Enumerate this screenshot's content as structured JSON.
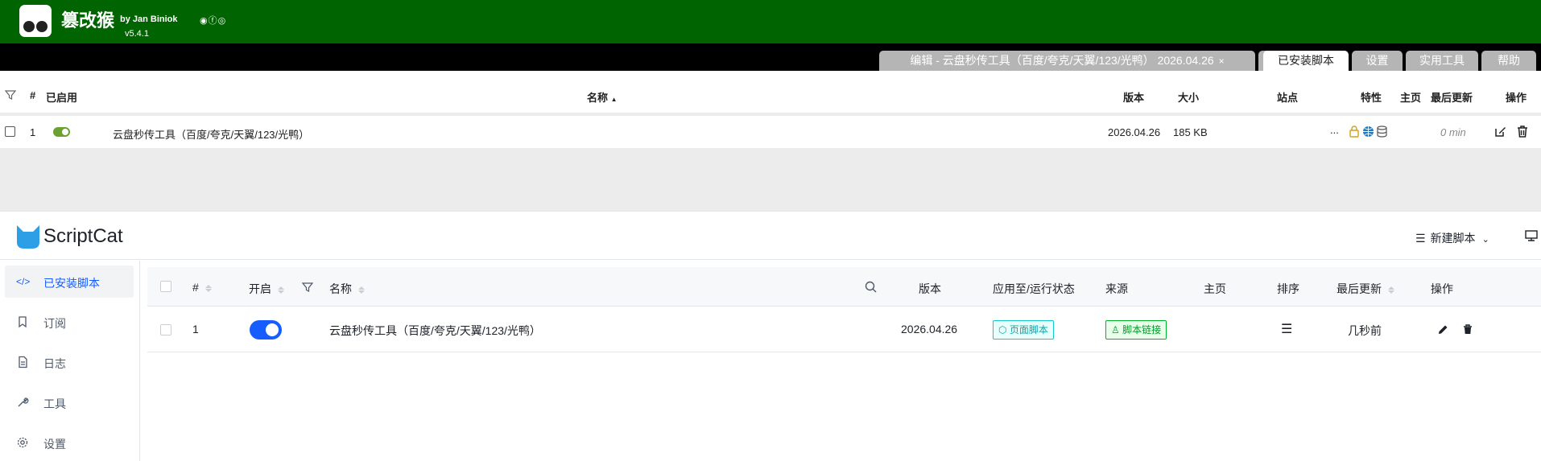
{
  "tampermonkey": {
    "title": "篡改猴",
    "by": "by Jan Biniok",
    "version": "v5.4.1",
    "tabs": {
      "editor": "编辑 - 云盘秒传工具（百度/夸克/天翼/123/光鸭） 2026.04.26",
      "editor_close": "×",
      "new": "⊞",
      "installed": "已安装脚本",
      "settings": "设置",
      "utilities": "实用工具",
      "help": "帮助"
    },
    "table": {
      "headers": {
        "number": "#",
        "enabled": "已启用",
        "name": "名称",
        "name_sort": "▲",
        "version": "版本",
        "size": "大小",
        "sites": "站点",
        "features": "特性",
        "homepage": "主页",
        "last_updated": "最后更新",
        "actions": "操作"
      },
      "rows": [
        {
          "index": "1",
          "name": "云盘秒传工具（百度/夸克/天翼/123/光鸭）",
          "version": "2026.04.26",
          "size": "185 KB",
          "sites": "...",
          "last_updated": "0 min"
        }
      ]
    }
  },
  "scriptcat": {
    "brand": "ScriptCat",
    "new_script": "新建脚本",
    "sidebar": [
      {
        "label": "已安装脚本",
        "icon": "code-icon"
      },
      {
        "label": "订阅",
        "icon": "bookmark-icon"
      },
      {
        "label": "日志",
        "icon": "file-icon"
      },
      {
        "label": "工具",
        "icon": "tool-icon"
      },
      {
        "label": "设置",
        "icon": "gear-icon"
      }
    ],
    "table": {
      "headers": {
        "number": "#",
        "enabled": "开启",
        "name": "名称",
        "version": "版本",
        "apply_status": "应用至/运行状态",
        "source": "来源",
        "homepage": "主页",
        "order": "排序",
        "last_updated": "最后更新",
        "actions": "操作"
      },
      "rows": [
        {
          "index": "1",
          "name": "云盘秒传工具（百度/夸克/天翼/123/光鸭）",
          "version": "2026.04.26",
          "apply_tag": "页面脚本",
          "source_tag": "脚本链接",
          "last_updated": "几秒前"
        }
      ]
    }
  },
  "colors": {
    "tm_green": "#006400",
    "tm_toggle": "#6ba032",
    "sc_blue": "#165dff"
  }
}
